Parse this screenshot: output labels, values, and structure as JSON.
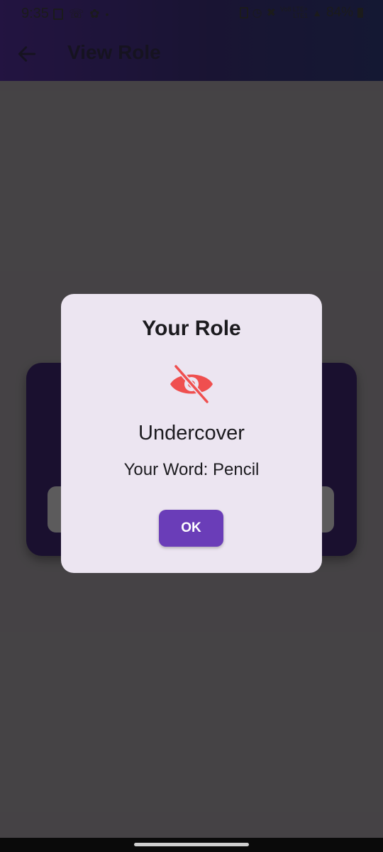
{
  "status_bar": {
    "time": "9:35",
    "network_top": "Vo8 LTE+",
    "network_bottom": "LTE1",
    "battery": "84%"
  },
  "toolbar": {
    "title": "View Role",
    "back_icon": "arrow-left-icon"
  },
  "dialog": {
    "title": "Your Role",
    "icon": "eye-off-icon",
    "icon_color": "#ef4f4f",
    "role": "Undercover",
    "word": "Your Word: Pencil",
    "ok_label": "OK"
  },
  "colors": {
    "accent": "#6a3db8",
    "card": "#2d1c52",
    "dialog_bg": "#ece5f1"
  }
}
